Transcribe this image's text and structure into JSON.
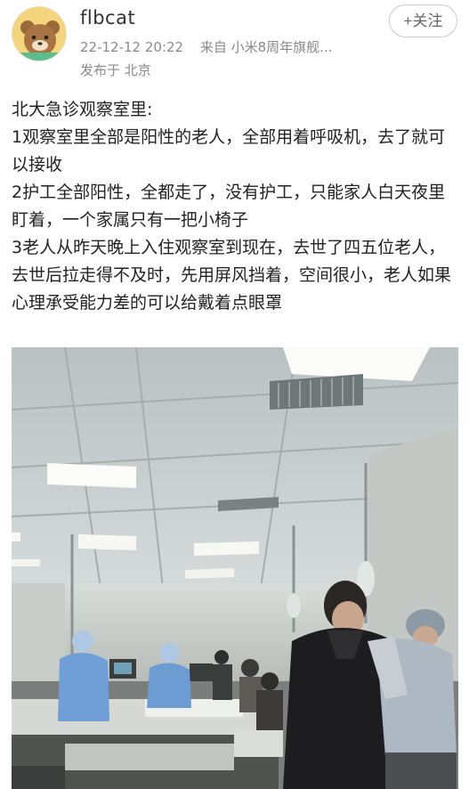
{
  "post": {
    "author": "flbcat",
    "timestamp": "22-12-12 20:22",
    "source": "来自 小米8周年旗舰...",
    "location": "发布于 北京",
    "follow_label": "+关注",
    "paragraphs": [
      "北大急诊观察室里:",
      "1观察室里全部是阳性的老人，全部用着呼吸机，去了就可以接收",
      "2护工全部阳性，全都走了，没有护工，只能家人白天夜里盯着，一个家属只有一把小椅子",
      "3老人从昨天晚上入住观察室到现在，去世了四五位老人，去世后拉走得不及时，先用屏风挡着，空间很小，老人如果心理承受能力差的可以给戴着点眼罩"
    ]
  },
  "icons": {
    "avatar": "bear-avatar-icon",
    "image": "hospital-ward-photo"
  }
}
